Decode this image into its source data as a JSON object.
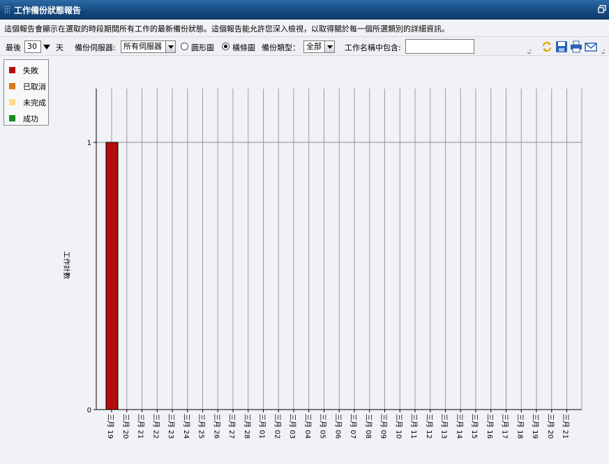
{
  "window": {
    "title": "工作備份狀態報告"
  },
  "description": "這個報告會顯示在選取的時段期間所有工作的最新備份狀態。這個報告能允許您深入檢視，以取得關於每一個所選類別的詳細資訊。",
  "toolbar": {
    "last_label": "最後",
    "days_value": "30",
    "days_unit": "天",
    "server_label": "備份伺服器:",
    "server_value": "所有伺服器",
    "pie_label": "圓形圖",
    "bar_label": "橫條圖",
    "selected_chart": "bar",
    "type_label": "備份類型：",
    "type_value": "全部",
    "jobname_label": "工作名稱中包含:",
    "jobname_value": ""
  },
  "legend": [
    {
      "label": "失敗",
      "color": "#b30d0d"
    },
    {
      "label": "已取消",
      "color": "#d97a10"
    },
    {
      "label": "未完成",
      "color": "#ffd98a"
    },
    {
      "label": "成功",
      "color": "#1a8a1a"
    }
  ],
  "chart_data": {
    "type": "bar",
    "ylabel": "工作計數",
    "ylim": [
      0,
      1
    ],
    "yticks": [
      "0",
      "1"
    ],
    "categories": [
      "三月 19",
      "三月 20",
      "三月 21",
      "三月 22",
      "三月 23",
      "三月 24",
      "三月 25",
      "三月 26",
      "三月 27",
      "三月 28",
      "三月 01",
      "三月 02",
      "三月 03",
      "三月 04",
      "三月 05",
      "三月 06",
      "三月 07",
      "三月 08",
      "三月 09",
      "三月 10",
      "三月 11",
      "三月 12",
      "三月 13",
      "三月 14",
      "三月 15",
      "三月 16",
      "三月 17",
      "三月 18",
      "三月 19",
      "三月 20",
      "三月 21"
    ],
    "series": [
      {
        "name": "失敗",
        "color": "#b30d0d",
        "values": [
          1,
          0,
          0,
          0,
          0,
          0,
          0,
          0,
          0,
          0,
          0,
          0,
          0,
          0,
          0,
          0,
          0,
          0,
          0,
          0,
          0,
          0,
          0,
          0,
          0,
          0,
          0,
          0,
          0,
          0,
          0
        ]
      }
    ]
  }
}
